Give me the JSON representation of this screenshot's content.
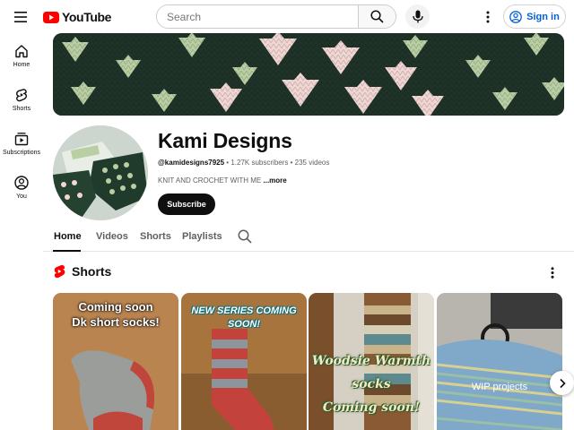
{
  "header": {
    "logo_text": "YouTube",
    "search_placeholder": "Search",
    "signin_label": "Sign in"
  },
  "sidebar": {
    "items": [
      {
        "label": "Home",
        "icon": "home-icon"
      },
      {
        "label": "Shorts",
        "icon": "shorts-icon"
      },
      {
        "label": "Subscriptions",
        "icon": "subscriptions-icon"
      },
      {
        "label": "You",
        "icon": "you-icon"
      }
    ]
  },
  "channel": {
    "name": "Kami Designs",
    "handle": "@kamidesigns7925",
    "subscribers": "1.27K subscribers",
    "videos": "235 videos",
    "separator": "•",
    "description": "KNIT AND CROCHET WITH ME",
    "more_label": "...more",
    "subscribe_label": "Subscribe"
  },
  "tabs": [
    {
      "label": "Home",
      "active": true
    },
    {
      "label": "Videos",
      "active": false
    },
    {
      "label": "Shorts",
      "active": false
    },
    {
      "label": "Playlists",
      "active": false
    }
  ],
  "shorts": {
    "title": "Shorts",
    "items": [
      {
        "line1": "Coming soon",
        "line2": "Dk short socks!"
      },
      {
        "line1": "NEW SERIES COMING",
        "line2": "SOON!"
      },
      {
        "line1": "Woodsie Warmth",
        "line2": "socks",
        "line3": "Coming soon!"
      },
      {
        "line1": "WIP projects"
      }
    ]
  },
  "colors": {
    "youtube_red": "#ff0000",
    "signin_blue": "#065fd4",
    "subscribe_bg": "#0f0f0f",
    "banner_dark": "#1f3329",
    "banner_pink": "#f1d6d3",
    "banner_green": "#b9cfa3"
  }
}
